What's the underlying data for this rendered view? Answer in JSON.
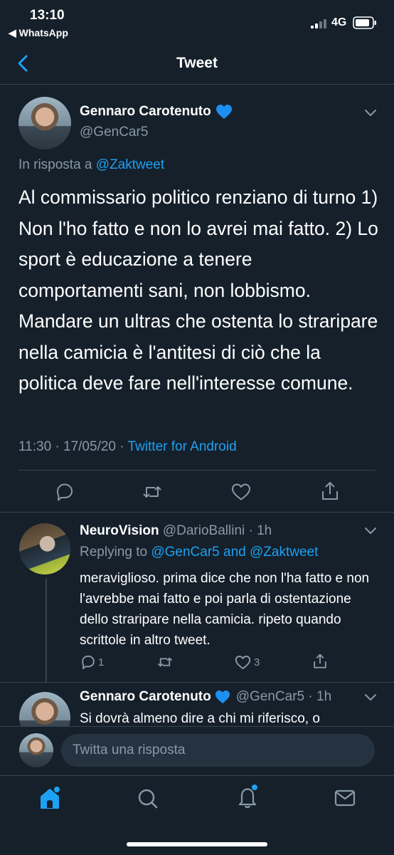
{
  "status_bar": {
    "time": "13:10",
    "back_app": "◀ WhatsApp",
    "network": "4G"
  },
  "header": {
    "title": "Tweet"
  },
  "main_tweet": {
    "author_name": "Gennaro Carotenuto",
    "author_handle": "@GenCar5",
    "reply_prefix": "In risposta a",
    "reply_to": "@Zaktweet",
    "text": "Al commissario politico renziano di turno 1) Non l'ho fatto e non lo avrei mai fatto. 2) Lo sport è educazione a tenere comportamenti sani, non lobbismo. Mandare un ultras che ostenta lo straripare nella camicia è l'antitesi di ciò che la politica deve fare nell'interesse comune.",
    "timestamp": "11:30 · 17/05/20 · ",
    "source": "Twitter for Android"
  },
  "reply_1": {
    "author_name": "NeuroVision",
    "author_handle": "@DarioBallini",
    "time": " · 1h",
    "replying_prefix": "Replying to",
    "replying_to": "@GenCar5 and @Zaktweet",
    "text": "meraviglioso. prima dice che non l'ha fatto e non l'avrebbe mai fatto e poi parla di ostentazione dello straripare nella camicia. ripeto quando scrittole in altro tweet.",
    "reply_count": "1",
    "like_count": "3"
  },
  "reply_2": {
    "author_name": "Gennaro Carotenuto",
    "author_handle": "@GenCar5",
    "time": " · 1h",
    "text": "Si dovrà almeno dire a chi mi riferisco, o"
  },
  "compose": {
    "placeholder": "Twitta una risposta"
  },
  "colors": {
    "background": "#15202b",
    "accent": "#1da1f2",
    "muted": "#8899a6",
    "divider": "#38444d"
  }
}
